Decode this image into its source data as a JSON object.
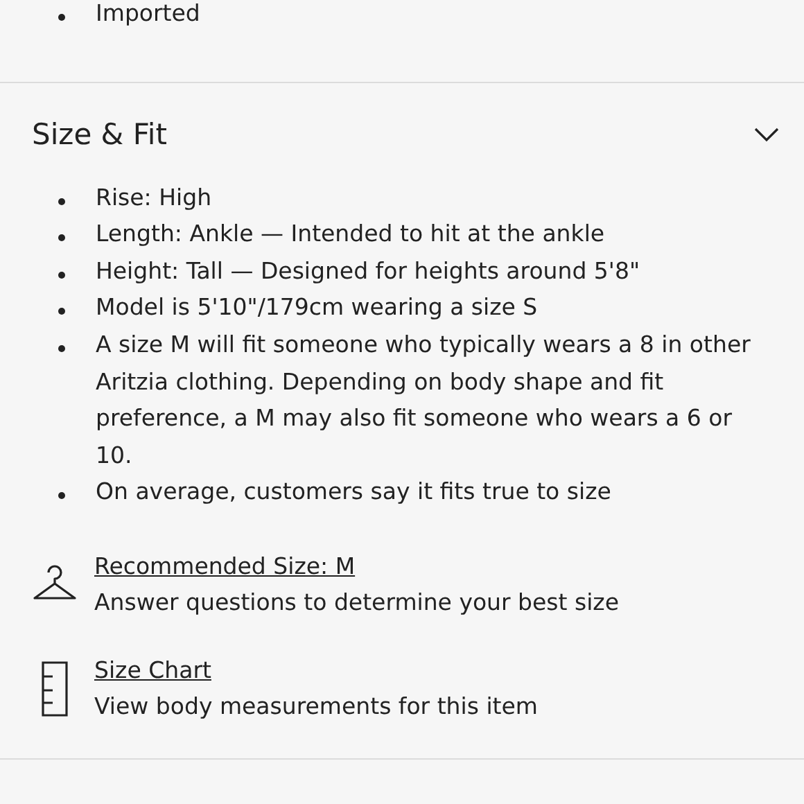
{
  "previous_section": {
    "bullets": [
      "Imported"
    ]
  },
  "section": {
    "title": "Size & Fit",
    "expanded": true,
    "bullets": [
      "Rise: High",
      "Length: Ankle — Intended to hit at the ankle",
      "Height: Tall — Designed for heights around 5'8\"",
      "Model is 5'10\"/179cm wearing a size S",
      "A size M will fit someone who typically wears a 8 in other Aritzia clothing. Depending on body shape and fit preference, a M may also fit someone who wears a 6 or 10.",
      "On average, customers say it fits true to size"
    ],
    "tools": [
      {
        "kind": "hanger",
        "link": "Recommended Size: M",
        "description": "Answer questions to determine your best size"
      },
      {
        "kind": "ruler",
        "link": "Size Chart",
        "description": "View body measurements for this item"
      }
    ]
  }
}
